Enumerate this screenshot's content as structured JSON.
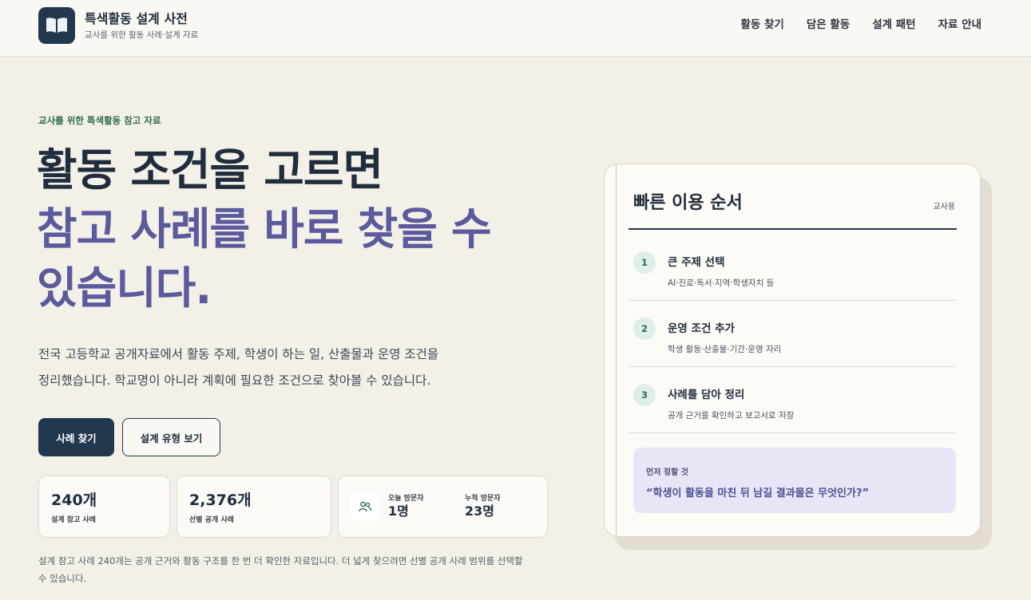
{
  "brand": {
    "title": "특색활동 설계 사전",
    "subtitle": "교사를 위한 활동 사례·설계 자료"
  },
  "nav": {
    "items": [
      "활동 찾기",
      "담은 활동",
      "설계 패턴",
      "자료 안내"
    ]
  },
  "hero": {
    "eyebrow": "교사를 위한 특색활동 참고 자료",
    "headline_line1": "활동 조건을 고르면",
    "headline_line2": "참고 사례를 바로 찾을 수",
    "headline_line3": "있습니다.",
    "desc_line1": "전국 고등학교 공개자료에서 활동 주제, 학생이 하는 일, 산출물과 운영 조건을",
    "desc_line2": "정리했습니다. 학교명이 아니라 계획에 필요한 조건으로 찾아볼 수 있습니다.",
    "primary_button": "사례 찾기",
    "secondary_button": "설계 유형 보기"
  },
  "stats": {
    "design_cases": {
      "value": "240개",
      "label": "설계 참고 사례"
    },
    "public_cases": {
      "value": "2,376개",
      "label": "선별 공개 사례"
    },
    "visitors": {
      "today_label": "오늘 방문자",
      "today_value": "1명",
      "total_label": "누적 방문자",
      "total_value": "23명"
    }
  },
  "footnote": {
    "line1": "설계 참고 사례 240개는 공개 근거와 활동 구조를 한 번 더 확인한 자료입니다. 더 넓게 찾으려면 선별 공개 사례 범위를 선택할",
    "line2": "수 있습니다."
  },
  "guide": {
    "title": "빠른 이용 순서",
    "tag": "교사용",
    "steps": [
      {
        "num": "1",
        "title": "큰 주제 선택",
        "sub": "AI·진로·독서·지역·학생자치 등"
      },
      {
        "num": "2",
        "title": "운영 조건 추가",
        "sub": "학생 활동·산출물·기간·운영 자리"
      },
      {
        "num": "3",
        "title": "사례를 담아 정리",
        "sub": "공개 근거를 확인하고 보고서로 저장"
      }
    ],
    "callout_label": "먼저 정할 것",
    "callout_question": "“학생이 활동을 마친 뒤 남길 결과물은 무엇인가?”"
  },
  "colors": {
    "navy": "#22384f",
    "accent_purple": "#5a5a9c",
    "green": "#2f6b55",
    "background": "#f3f0e8"
  }
}
